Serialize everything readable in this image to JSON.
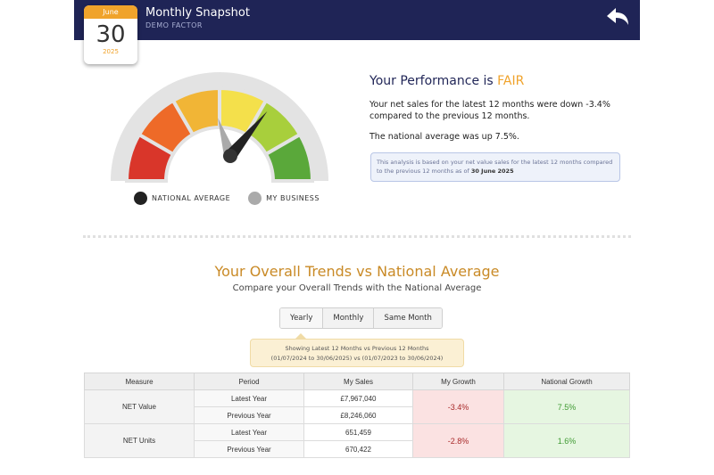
{
  "header": {
    "title": "Monthly Snapshot",
    "subtitle": "DEMO FACTOR",
    "back_icon": "back-arrow-icon",
    "background_color": "#1f2456"
  },
  "calendar": {
    "month": "June",
    "day": "30",
    "year": "2025",
    "accent_color": "#f0a32b"
  },
  "gauge": {
    "segment_colors": [
      "#d9362a",
      "#ee6a28",
      "#f1b536",
      "#f4e04b",
      "#a8cf3c",
      "#5aa83a"
    ],
    "national_average_level": 0.4,
    "my_business_level": 0.72,
    "legend": {
      "national_average": "NATIONAL AVERAGE",
      "my_business": "MY BUSINESS"
    }
  },
  "performance": {
    "title_prefix": "Your Performance is ",
    "rating": "FAIR",
    "line1": "Your net sales for the latest 12 months were down -3.4% compared to the previous 12 months.",
    "line2": "The national average was up 7.5%.",
    "note_text": "This analysis is based on your net value sales for the latest 12 months compared to the previous 12 months as of ",
    "note_date": "30 June 2025"
  },
  "trends": {
    "title": "Your Overall Trends vs National Average",
    "subtitle": "Compare your Overall Trends with the National Average",
    "tabs": [
      "Yearly",
      "Monthly",
      "Same Month"
    ],
    "active_tab": "Yearly",
    "info_line1": "Showing Latest 12 Months vs Previous 12 Months",
    "info_line2": "(01/07/2024 to 30/06/2025) vs (01/07/2023 to 30/06/2024)"
  },
  "table": {
    "headers": [
      "Measure",
      "Period",
      "My Sales",
      "My Growth",
      "National Growth"
    ],
    "rows": [
      {
        "measure": "NET Value",
        "periods": [
          "Latest Year",
          "Previous Year"
        ],
        "sales": [
          "£7,967,040",
          "£8,246,060"
        ],
        "my_growth": "-3.4%",
        "national_growth": "7.5%"
      },
      {
        "measure": "NET Units",
        "periods": [
          "Latest Year",
          "Previous Year"
        ],
        "sales": [
          "651,459",
          "670,422"
        ],
        "my_growth": "-2.8%",
        "national_growth": "1.6%"
      }
    ]
  }
}
